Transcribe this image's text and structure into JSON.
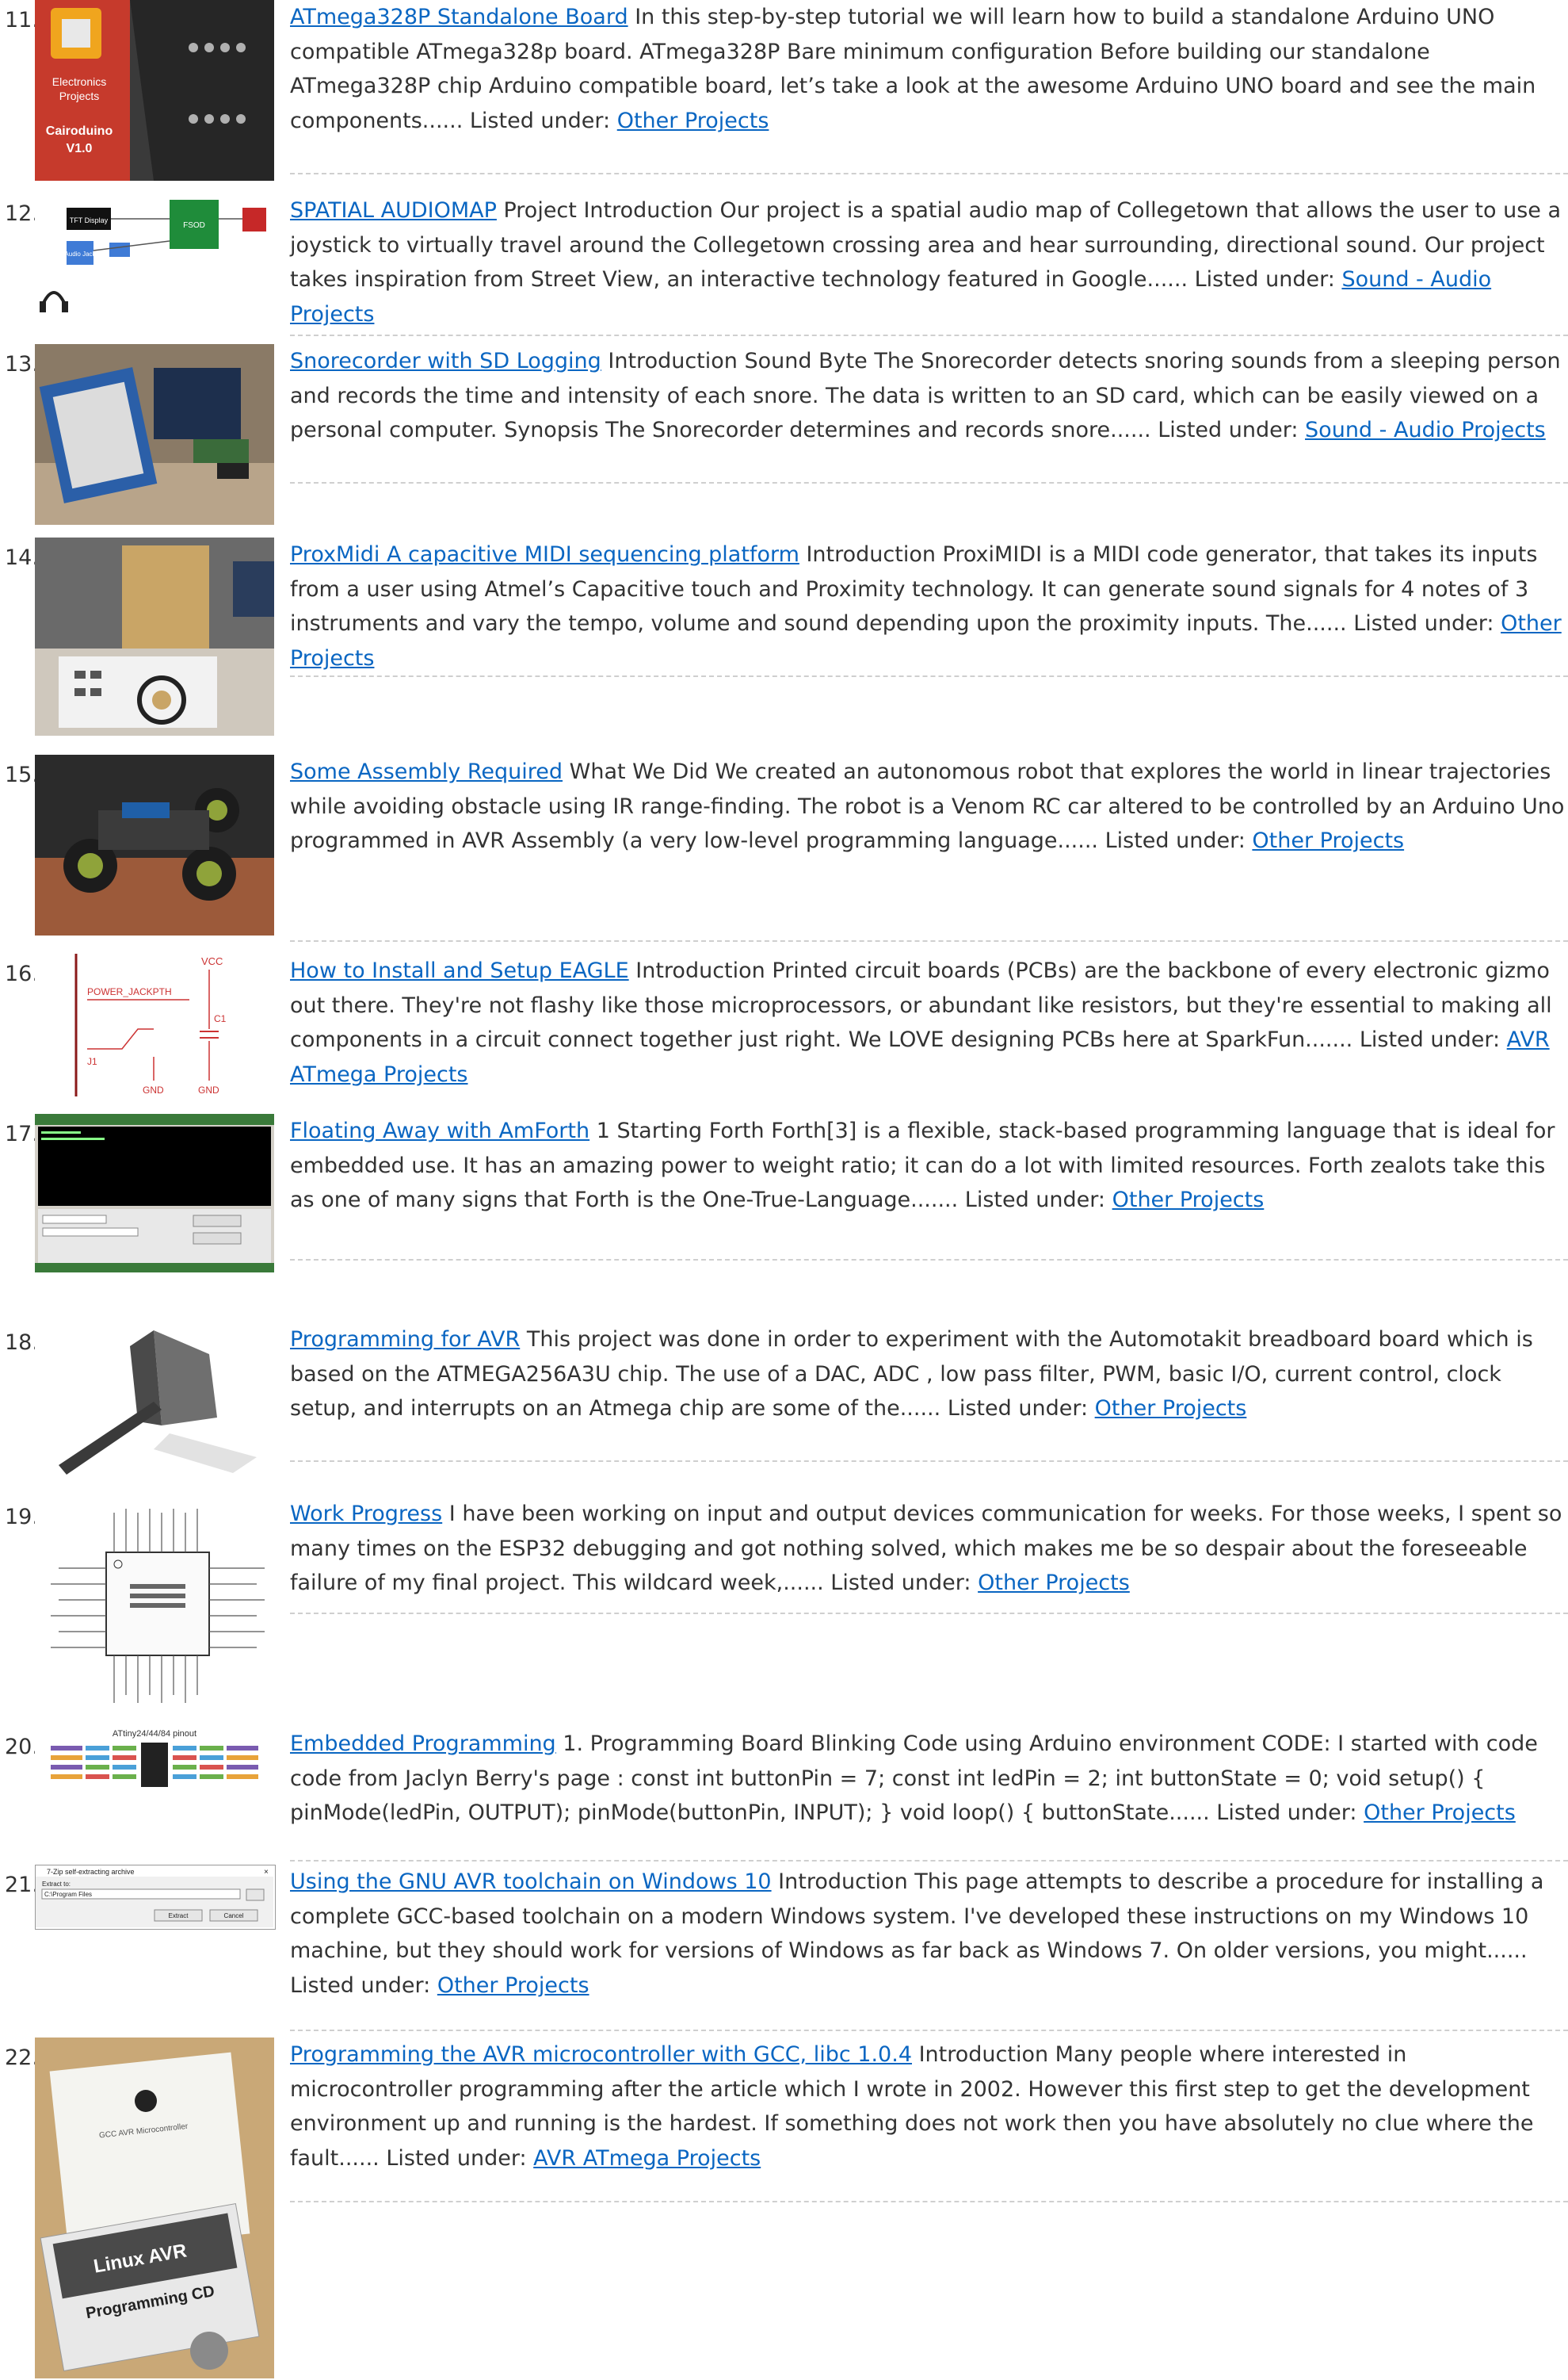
{
  "listed_label": "Listed under:",
  "items": [
    {
      "number": "11.",
      "title": "ATmega328P Standalone Board",
      "text": " In this step-by-step tutorial we will learn how to build a standalone Arduino UNO compatible ATmega328p board. ATmega328P Bare minimum configuration Before building our standalone ATmega328P chip Arduino compatible board, let’s take a look at the awesome Arduino UNO board and see the main components...... ",
      "category": "Other Projects",
      "thumb_text": [
        "Electronics",
        "Projects",
        "Cairoduino",
        "V1.0"
      ]
    },
    {
      "number": "12.",
      "title": "SPATIAL AUDIOMAP",
      "text": " Project Introduction Our project is a spatial audio map of Collegetown that allows the user to use a joystick to virtually travel around the Collegetown crossing area and hear surrounding, directional sound. Our project takes inspiration from Street View, an interactive technology featured in Google...... ",
      "category": "Sound - Audio Projects",
      "thumb_text": [
        "TFT Display",
        "FSOD",
        "Audio Jack"
      ]
    },
    {
      "number": "13.",
      "title": "Snorecorder with SD Logging",
      "text": " Introduction Sound Byte The Snorecorder detects snoring sounds from a sleeping person and records the time and intensity of each snore. The data is written to an SD card, which can be easily viewed on a personal computer. Synopsis The Snorecorder determines and records snore...... ",
      "category": "Sound - Audio Projects"
    },
    {
      "number": "14.",
      "title": "ProxMidi A capacitive MIDI sequencing platform",
      "text": " Introduction ProxiMIDI is a MIDI code generator, that takes its inputs from a user using Atmel’s Capacitive touch and Proximity technology. It can generate sound signals for 4 notes of 3 instruments and vary the tempo, volume and sound depending upon the proximity inputs. The...... ",
      "category": "Other Projects"
    },
    {
      "number": "15.",
      "title": "Some Assembly Required",
      "text": " What We Did We created an autonomous robot that explores the world in linear trajectories while avoiding obstacle using IR range-finding. The robot is a Venom RC car altered to be controlled by an Arduino Uno programmed in AVR Assembly (a very low-level programming language...... ",
      "category": "Other Projects"
    },
    {
      "number": "16.",
      "title": "How to Install and Setup EAGLE",
      "text": " Introduction Printed circuit boards (PCBs) are the backbone of every electronic gizmo out there. They're not flashy like those microprocessors, or abundant like resistors, but they're essential to making all components in a circuit connect together just right. We LOVE designing PCBs here at SparkFun....... ",
      "category": "AVR ATmega Projects",
      "thumb_text": [
        "VCC",
        "POWER_JACKPTH",
        "C1",
        "J1",
        "GND",
        "GND"
      ]
    },
    {
      "number": "17.",
      "title": "Floating Away with AmForth",
      "text": " 1    Starting Forth Forth[3] is a flexible, stack-based programming language that is ideal for embedded use. It has an amazing power to weight ratio; it can do a lot with limited resources. Forth zealots take this as one of many signs that Forth is the One-True-Language....... ",
      "category": "Other Projects"
    },
    {
      "number": "18.",
      "title": "Programming for AVR",
      "text": " This project was done in order to experiment with the Automotakit breadboard board which is based on the ATMEGA256A3U chip. The use of a DAC, ADC , low pass filter, PWM, basic I/O, current control, clock setup, and interrupts on an Atmega chip are some of the...... ",
      "category": "Other Projects"
    },
    {
      "number": "19.",
      "title": "Work Progress",
      "text": " I have been working on input and output devices communication for weeks. For those weeks, I spent so many times on the ESP32 debugging and got nothing solved, which makes me be so despair about the foreseeable failure of my final project. This wildcard week,...... ",
      "category": "Other Projects"
    },
    {
      "number": "20.",
      "title": "Embedded Programming",
      "text": " 1. Programming Board Blinking Code using Arduino environment CODE: I started with code code from Jaclyn Berry's page : const int buttonPin = 7; const int ledPin = 2; int buttonState = 0; void setup() { pinMode(ledPin, OUTPUT); pinMode(buttonPin, INPUT); } void loop() { buttonState...... ",
      "category": "Other Projects",
      "thumb_text": [
        "ATtiny24/44/84 pinout"
      ]
    },
    {
      "number": "21.",
      "title": "Using the GNU AVR toolchain on Windows 10",
      "text": " Introduction This page attempts to describe a procedure for installing a complete GCC-based toolchain on a modern Windows system. I've developed these instructions on my Windows 10 machine, but they should work for versions of Windows as far back as Windows 7. On older versions, you might...... ",
      "category": "Other Projects",
      "thumb_text": [
        "7-Zip self-extracting archive",
        "Extract to:",
        "C:\\Program Files",
        "Extract",
        "Cancel"
      ]
    },
    {
      "number": "22.",
      "title": "Programming the AVR microcontroller with GCC, libc 1.0.4",
      "text": " Introduction Many people where interested in microcontroller programming after the article which I wrote in 2002. However this first step to get the development environment up and running is the hardest. If something does not work then you have absolutely no clue where the fault...... ",
      "category": "AVR ATmega Projects",
      "thumb_text": [
        "Linux AVR",
        "Programming CD"
      ]
    }
  ],
  "colors": {
    "link": "#0a66c2",
    "text": "#333333",
    "separator": "#cfcfcf"
  }
}
